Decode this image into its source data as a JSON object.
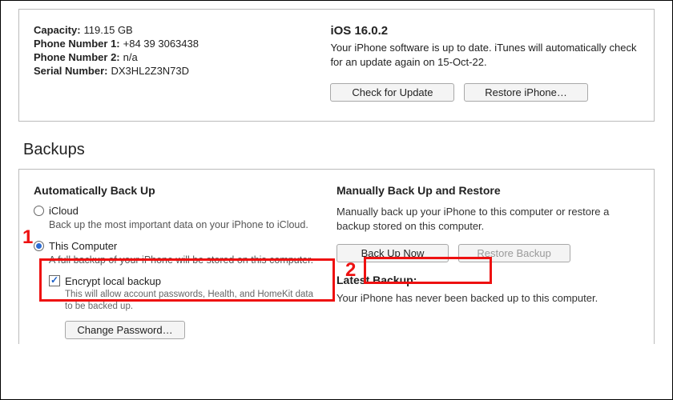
{
  "device": {
    "capacity_label": "Capacity:",
    "capacity_value": "119.15 GB",
    "phone1_label": "Phone Number 1:",
    "phone1_value": "+84 39 3063438",
    "phone2_label": "Phone Number 2:",
    "phone2_value": "n/a",
    "serial_label": "Serial Number:",
    "serial_value": "DX3HL2Z3N73D"
  },
  "software": {
    "title": "iOS 16.0.2",
    "status": "Your iPhone software is up to date. iTunes will automatically check for an update again on 15-Oct-22.",
    "check_label": "Check for Update",
    "restore_label": "Restore iPhone…"
  },
  "backups": {
    "section_title": "Backups",
    "auto_title": "Automatically Back Up",
    "icloud": {
      "label": "iCloud",
      "desc": "Back up the most important data on your iPhone to iCloud."
    },
    "thispc": {
      "label": "This Computer",
      "desc": "A full backup of your iPhone will be stored on this computer."
    },
    "encrypt": {
      "label": "Encrypt local backup",
      "desc": "This will allow account passwords, Health, and HomeKit data to be backed up.",
      "change_pw": "Change Password…"
    },
    "manual": {
      "title": "Manually Back Up and Restore",
      "desc": "Manually back up your iPhone to this computer or restore a backup stored on this computer.",
      "backup_now": "Back Up Now",
      "restore_backup": "Restore Backup"
    },
    "latest": {
      "title": "Latest Backup:",
      "desc": "Your iPhone has never been backed up to this computer."
    }
  },
  "callouts": {
    "n1": "1",
    "n2": "2"
  }
}
